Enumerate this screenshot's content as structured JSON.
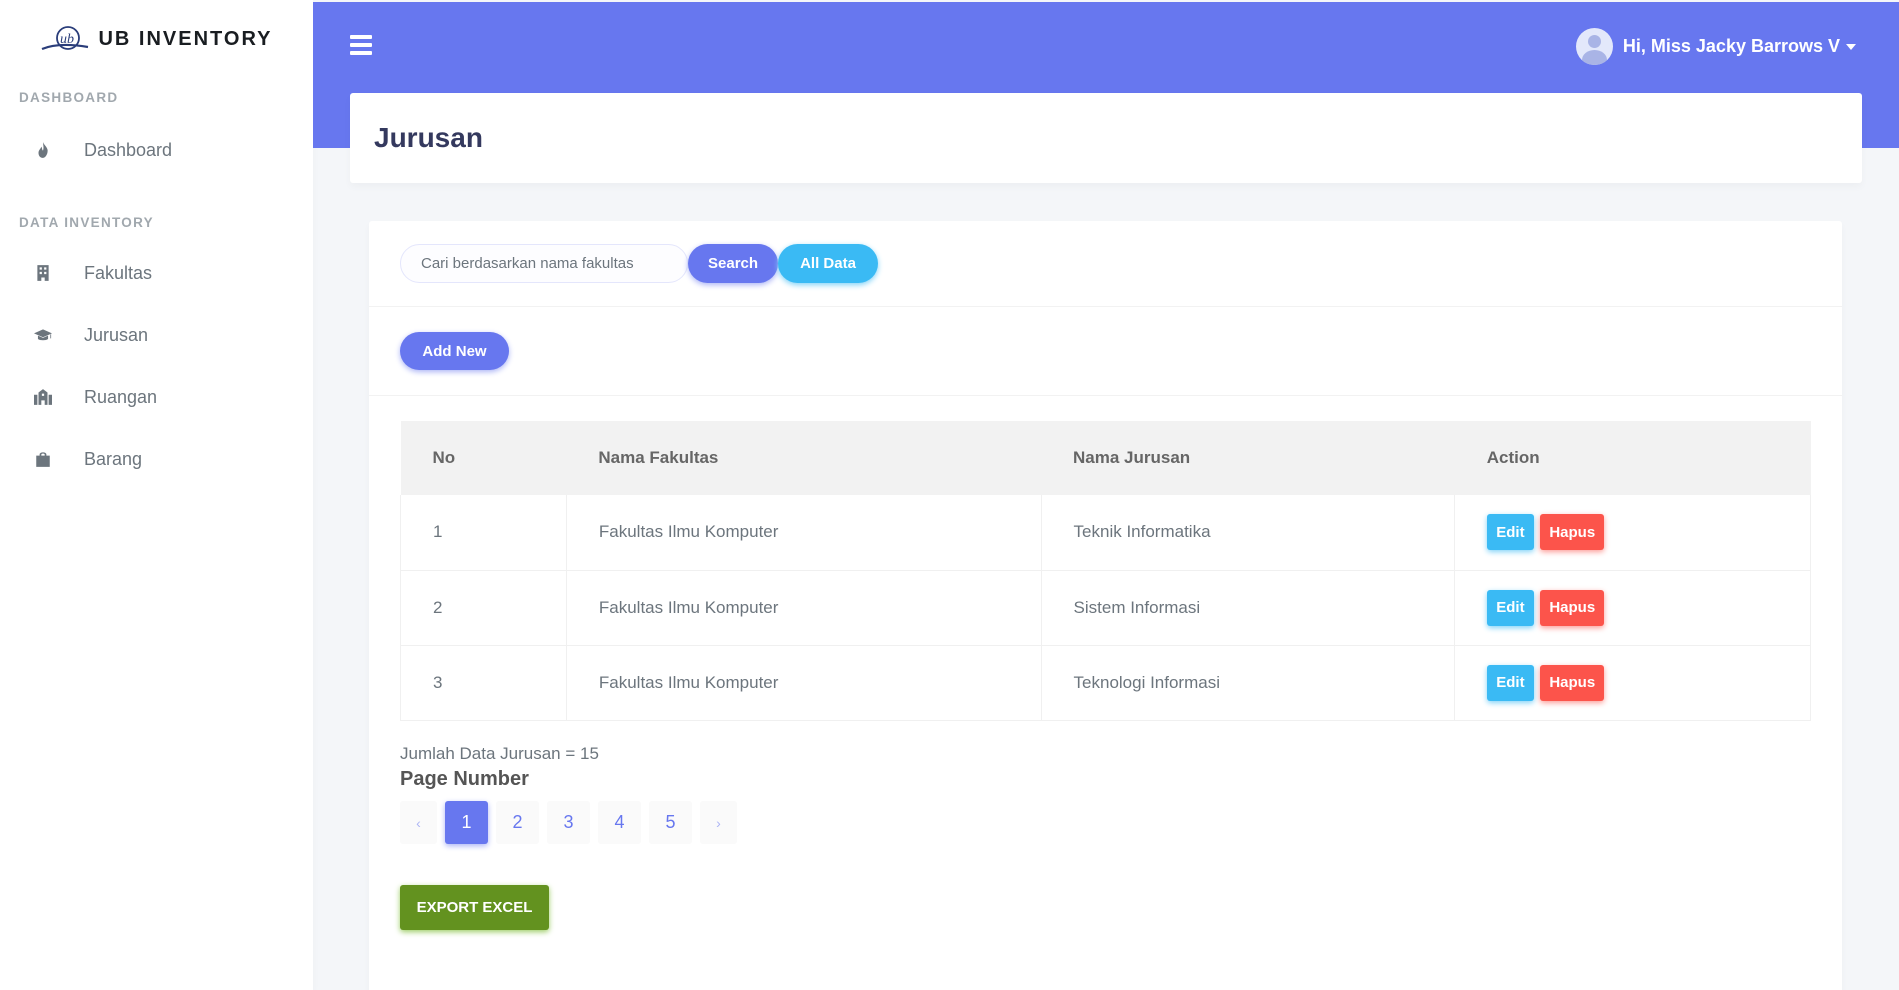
{
  "brand": {
    "name": "UB INVENTORY",
    "logo_text": "ub"
  },
  "sidebar": {
    "sections": [
      {
        "header": "DASHBOARD",
        "items": [
          {
            "label": "Dashboard",
            "icon": "fire-icon"
          }
        ]
      },
      {
        "header": "DATA INVENTORY",
        "items": [
          {
            "label": "Fakultas",
            "icon": "building-icon"
          },
          {
            "label": "Jurusan",
            "icon": "graduation-cap-icon"
          },
          {
            "label": "Ruangan",
            "icon": "school-icon"
          },
          {
            "label": "Barang",
            "icon": "shopping-bag-icon"
          }
        ]
      }
    ]
  },
  "topbar": {
    "user_greeting": "Hi, Miss Jacky Barrows V"
  },
  "page": {
    "title": "Jurusan"
  },
  "search": {
    "placeholder": "Cari berdasarkan nama fakultas",
    "search_label": "Search",
    "all_label": "All Data"
  },
  "add_label": "Add New",
  "table": {
    "headers": [
      "No",
      "Nama Fakultas",
      "Nama Jurusan",
      "Action"
    ],
    "rows": [
      {
        "no": "1",
        "fakultas": "Fakultas Ilmu Komputer",
        "jurusan": "Teknik Informatika"
      },
      {
        "no": "2",
        "fakultas": "Fakultas Ilmu Komputer",
        "jurusan": "Sistem Informasi"
      },
      {
        "no": "3",
        "fakultas": "Fakultas Ilmu Komputer",
        "jurusan": "Teknologi Informasi"
      }
    ],
    "edit_label": "Edit",
    "delete_label": "Hapus"
  },
  "count_text": "Jumlah Data Jurusan = 15",
  "pagination": {
    "label": "Page Number",
    "prev": "‹",
    "next": "›",
    "pages": [
      "1",
      "2",
      "3",
      "4",
      "5"
    ],
    "active": "1"
  },
  "export_label": "EXPORT EXCEL",
  "colors": {
    "primary": "#6777ef",
    "info": "#3abaf4",
    "danger": "#fc544b",
    "success": "#63921f"
  }
}
